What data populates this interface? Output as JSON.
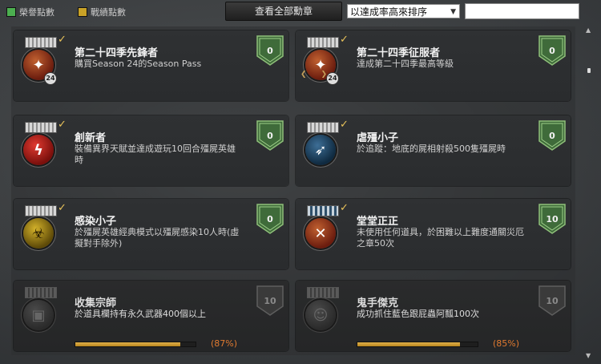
{
  "topbar": {
    "legend_honor": "榮譽點數",
    "legend_honor_color": "#4caf50",
    "legend_battle": "戰績點數",
    "legend_battle_color": "#c9a227",
    "view_all_button": "查看全部勳章",
    "sort_value": "以達成率高來排序",
    "search_value": ""
  },
  "cards": [
    {
      "title": "第二十四季先鋒者",
      "desc": "購買Season 24的Season Pass",
      "points": "0",
      "coin_text": "✦",
      "badge_text": "24",
      "completed": true
    },
    {
      "title": "第二十四季征服者",
      "desc": "達成第二十四季最高等級",
      "points": "0",
      "coin_text": "✦",
      "badge_text": "24",
      "completed": true
    },
    {
      "title": "創新者",
      "desc": "裝備異界天賦並達成遊玩10回合殭屍英雄時",
      "points": "0",
      "coin_text": "ϟ",
      "completed": true
    },
    {
      "title": "虐殭小子",
      "desc": "於追蹤：地底的屍相射殺500隻殭屍時",
      "points": "0",
      "coin_text": "➶",
      "completed": true
    },
    {
      "title": "感染小子",
      "desc": "於殭屍英雄經典模式以殭屍感染10人時(虛擬對手除外)",
      "points": "0",
      "coin_text": "☣",
      "completed": true
    },
    {
      "title": "堂堂正正",
      "desc": "未使用任何道具，於困難以上難度通關災厄之章50次",
      "points": "10",
      "coin_text": "✕",
      "completed": true
    },
    {
      "title": "收集宗師",
      "desc": "於道具欄持有永久武器400個以上",
      "points": "10",
      "coin_text": "▣",
      "completed": false,
      "progress": 0.87,
      "progress_label": "(87%)"
    },
    {
      "title": "鬼手傑克",
      "desc": "成功抓住藍色跟屁蟲阿瓢100次",
      "points": "10",
      "coin_text": "☺",
      "completed": false,
      "progress": 0.85,
      "progress_label": "(85%)"
    }
  ]
}
